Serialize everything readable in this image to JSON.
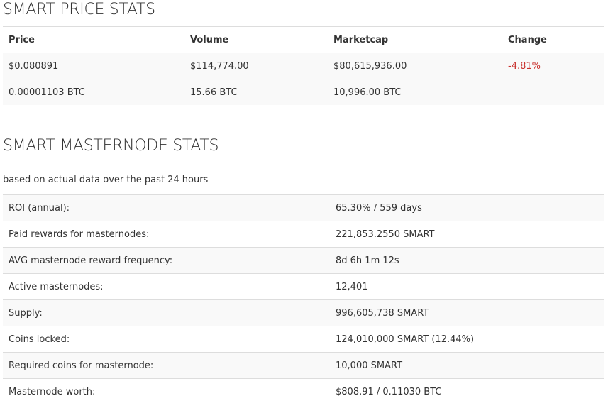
{
  "price_stats": {
    "title": "SMART PRICE STATS",
    "headers": [
      "Price",
      "Volume",
      "Marketcap",
      "Change"
    ],
    "rows": [
      [
        "$0.080891",
        "$114,774.00",
        "$80,615,936.00",
        "-4.81%"
      ],
      [
        "0.00001103 BTC",
        "15.66 BTC",
        "10,996.00 BTC",
        ""
      ]
    ],
    "negative_color": "#c9302c"
  },
  "masternode_stats": {
    "title": "SMART MASTERNODE STATS",
    "subtitle": "based on actual data over the past 24 hours",
    "rows": [
      {
        "label": "ROI (annual):",
        "value": "65.30% / 559 days"
      },
      {
        "label": "Paid rewards for masternodes:",
        "value": "221,853.2550 SMART"
      },
      {
        "label": "AVG masternode reward frequency:",
        "value": "8d 6h 1m 12s"
      },
      {
        "label": "Active masternodes:",
        "value": "12,401"
      },
      {
        "label": "Supply:",
        "value": "996,605,738 SMART"
      },
      {
        "label": "Coins locked:",
        "value": "124,010,000 SMART (12.44%)"
      },
      {
        "label": "Required coins for masternode:",
        "value": "10,000 SMART"
      },
      {
        "label": "Masternode worth:",
        "value": "$808.91 / 0.11030 BTC"
      }
    ]
  }
}
